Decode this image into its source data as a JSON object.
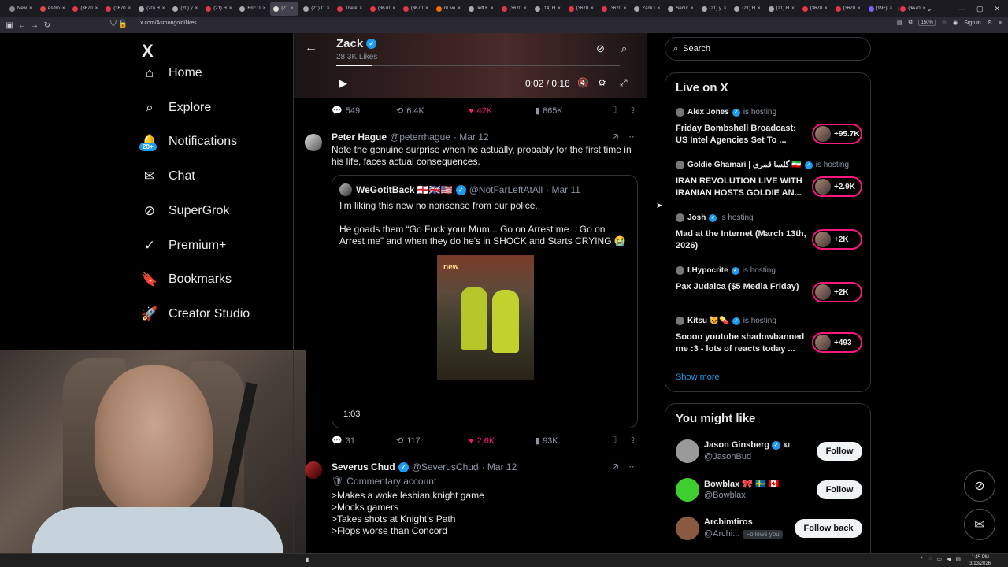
{
  "browser": {
    "tabs": [
      {
        "label": "New",
        "color": "#888"
      },
      {
        "label": "Asmo",
        "color": "#e04a4a"
      },
      {
        "label": "(3670",
        "color": "#e8354a"
      },
      {
        "label": "(3670",
        "color": "#e8354a"
      },
      {
        "label": "(20) H",
        "color": "#aaa"
      },
      {
        "label": "(20) y",
        "color": "#aaa"
      },
      {
        "label": "(21) H",
        "color": "#e8354a"
      },
      {
        "label": "Eric D",
        "color": "#aaa"
      },
      {
        "label": "(21",
        "color": "#ddd",
        "active": true
      },
      {
        "label": "(21) C",
        "color": "#aaa"
      },
      {
        "label": "The k",
        "color": "#e8354a"
      },
      {
        "label": "(3670",
        "color": "#e8354a"
      },
      {
        "label": "(3670",
        "color": "#e8354a"
      },
      {
        "label": "r/Live",
        "color": "#ff6a00"
      },
      {
        "label": "Jeff K",
        "color": "#aaa"
      },
      {
        "label": "(3670",
        "color": "#e8354a"
      },
      {
        "label": "(14) H",
        "color": "#aaa"
      },
      {
        "label": "(3670",
        "color": "#e8354a"
      },
      {
        "label": "(3670",
        "color": "#e8354a"
      },
      {
        "label": "Zack I",
        "color": "#aaa"
      },
      {
        "label": "Secur",
        "color": "#aaa"
      },
      {
        "label": "(21) y",
        "color": "#aaa"
      },
      {
        "label": "(21) H",
        "color": "#aaa"
      },
      {
        "label": "(21) H",
        "color": "#aaa"
      },
      {
        "label": "(3670",
        "color": "#e8354a"
      },
      {
        "label": "(3670",
        "color": "#e8354a"
      },
      {
        "label": "(99+)",
        "color": "#7b61ff"
      },
      {
        "label": "(3670",
        "color": "#e8354a"
      }
    ],
    "url": "x.com/Asmongold/likes",
    "zoom": "150%",
    "sign_in": "Sign in"
  },
  "sidebar": {
    "logo": "X",
    "notif_badge": "20+",
    "items": [
      {
        "label": "Home",
        "icon": "home-icon",
        "glyph": "⌂"
      },
      {
        "label": "Explore",
        "icon": "search-icon",
        "glyph": "⌕"
      },
      {
        "label": "Notifications",
        "icon": "bell-icon",
        "glyph": "🔔"
      },
      {
        "label": "Chat",
        "icon": "mail-icon",
        "glyph": "✉"
      },
      {
        "label": "SuperGrok",
        "icon": "grok-icon",
        "glyph": "⊘"
      },
      {
        "label": "Premium+",
        "icon": "verified-icon",
        "glyph": "✓"
      },
      {
        "label": "Bookmarks",
        "icon": "bookmark-icon",
        "glyph": "🔖"
      },
      {
        "label": "Creator Studio",
        "icon": "rocket-icon",
        "glyph": "🚀"
      }
    ]
  },
  "video_header": {
    "name": "Zack",
    "likes": "28.3K Likes",
    "time": "0:02 / 0:16",
    "progress": 0.125
  },
  "tweet0_actions": {
    "replies": "549",
    "reposts": "6.4K",
    "likes": "42K",
    "views": "865K"
  },
  "tweet1": {
    "name": "Peter Hague",
    "handle": "@peterrhague",
    "date": "· Mar 12",
    "text": "Note the genuine surprise when he actually, probably for the first time in his life, faces actual consequences.",
    "quote": {
      "name": "WeGotitBack 🏴󠁧󠁢󠁥󠁮󠁧󠁿🇬🇧🇺🇸",
      "handle": "@NotFarLeftAtAll",
      "date": "· Mar 11",
      "line1": "I'm liking this new no nonsense from our police..",
      "line2": "He goads them “Go Fuck your Mum... Go on Arrest me .. Go on Arrest me” and when they do he's in SHOCK and Starts CRYING 😭",
      "media_sign": "new",
      "duration": "1:03"
    },
    "actions": {
      "replies": "31",
      "reposts": "117",
      "likes": "2.6K",
      "views": "93K"
    }
  },
  "tweet2": {
    "name": "Severus Chud",
    "handle": "@SeverusChud",
    "date": "· Mar 12",
    "label": "Commentary account",
    "lines": [
      ">Makes a woke lesbian knight game",
      ">Mocks gamers",
      ">Takes shots at Knight's Path",
      ">Flops worse than Concord"
    ]
  },
  "search": {
    "placeholder": "Search"
  },
  "live": {
    "title": "Live on X",
    "status": "is hosting",
    "rows": [
      {
        "host": "Alex Jones",
        "title": "Friday Bombshell Broadcast: US Intel Agencies Set To ...",
        "count": "+95.7K"
      },
      {
        "host": "Goldie Ghamari | گلسا قمری 🇮🇷",
        "title": "IRAN REVOLUTION LIVE WITH IRANIAN HOSTS GOLDIE AN...",
        "count": "+2.9K"
      },
      {
        "host": "Josh",
        "title": "Mad at the Internet (March 13th, 2026)",
        "count": "+2K"
      },
      {
        "host": "I,Hypocrite",
        "title": "Pax Judaica ($5 Media Friday)",
        "count": "+2K"
      },
      {
        "host": "Kitsu 😼💊",
        "title": "Soooo youtube shadowbanned me :3 - lots of reacts today ...",
        "count": "+493"
      }
    ],
    "show_more": "Show more"
  },
  "suggestions": {
    "title": "You might like",
    "items": [
      {
        "name": "Jason Ginsberg",
        "suffix": "𝕏I",
        "handle": "@JasonBud",
        "button": "Follow",
        "follows_you": "",
        "color": "#9a9a9a"
      },
      {
        "name": "Bowblax 🎀 🇸🇪 🇨🇦",
        "suffix": "",
        "handle": "@Bowblax",
        "button": "Follow",
        "follows_you": "",
        "color": "#3ecf2e"
      },
      {
        "name": "Archimtiros",
        "suffix": "",
        "handle": "@Archi...",
        "button": "Follow back",
        "follows_you": "Follows you",
        "color": "#8a5a40"
      }
    ]
  },
  "taskbar": {
    "time": "1:45 PM",
    "date": "3/13/2026"
  }
}
